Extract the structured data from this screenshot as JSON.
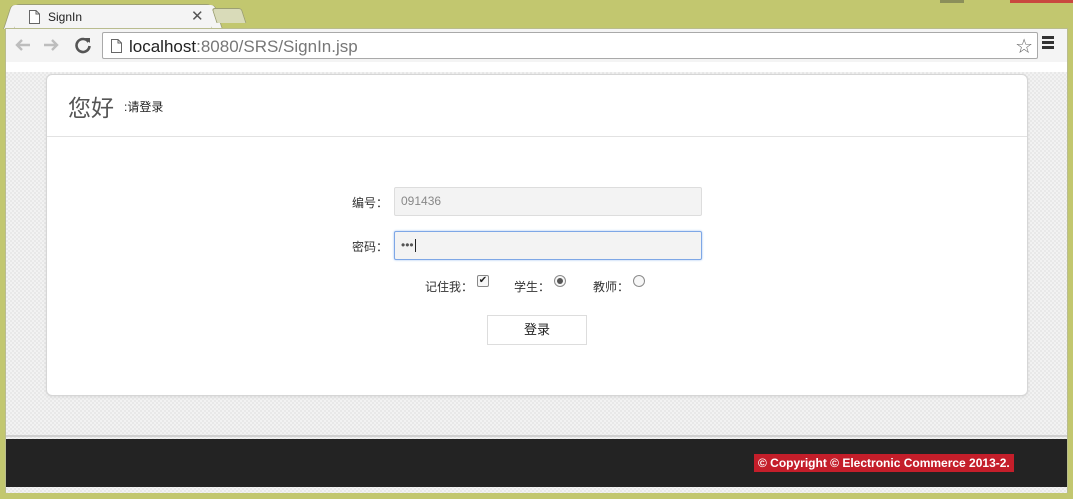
{
  "browser": {
    "tab_title": "SignIn",
    "tab_close": "✕",
    "url_host": "localhost",
    "url_rest": ":8080/SRS/SignIn.jsp"
  },
  "header": {
    "greeting": "您好",
    "subtitle": ":请登录"
  },
  "form": {
    "id_label": "编号：",
    "id_value": "091436",
    "password_label": "密码：",
    "password_mask": "•••",
    "remember_label": "记住我：",
    "remember_checked": true,
    "student_label": "学生：",
    "student_selected": true,
    "teacher_label": "教师：",
    "teacher_selected": false,
    "submit_label": "登录"
  },
  "footer": {
    "copyright": "© Copyright © Electronic Commerce 2013-2."
  },
  "colors": {
    "window_frame": "#c2c76f",
    "footer_bg": "#232323",
    "copyright_bg": "#c41e2a",
    "focus_border": "#7ea7e6"
  },
  "icons": [
    "page-icon",
    "back-arrow-icon",
    "forward-arrow-icon",
    "reload-icon",
    "star-icon",
    "menu-icon",
    "close-icon",
    "checkbox-checked-icon"
  ]
}
